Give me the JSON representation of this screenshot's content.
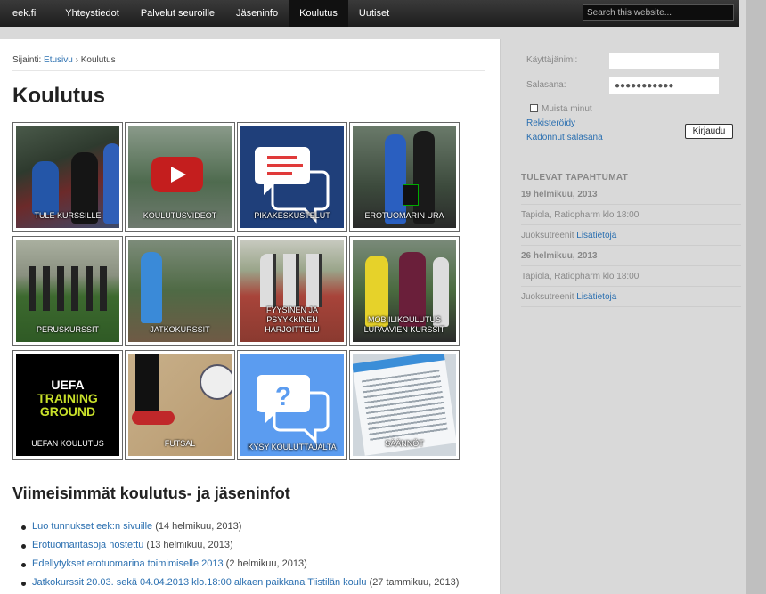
{
  "nav": {
    "items": [
      "eek.fi",
      "Yhteystiedot",
      "Palvelut seuroille",
      "Jäseninfo",
      "Koulutus",
      "Uutiset"
    ],
    "active": "Koulutus",
    "search_placeholder": "Search this website..."
  },
  "breadcrumb": {
    "prefix": "Sijainti:",
    "home": "Etusivu",
    "separator": "›",
    "current": "Koulutus"
  },
  "page_title": "Koulutus",
  "tiles": [
    {
      "label": "TULE KURSSILLE"
    },
    {
      "label": "KOULUTUSVIDEOT"
    },
    {
      "label": "PIKAKESKUSTELUT"
    },
    {
      "label": "EROTUOMARIN URA"
    },
    {
      "label": "PERUSKURSSIT"
    },
    {
      "label": "JATKOKURSSIT"
    },
    {
      "label": "FYYSINEN JA PSYYKKINEN HARJOITTELU"
    },
    {
      "label": "MOBIILIKOULUTUS LUPAAVIEN KURSSIT"
    },
    {
      "label": "UEFAN KOULUTUS",
      "logo": [
        "UEFA",
        "TRAINING",
        "GROUND"
      ]
    },
    {
      "label": "FUTSAL"
    },
    {
      "label": "KYSY KOULUTTAJALTA"
    },
    {
      "label": "SÄÄNNÖT"
    }
  ],
  "latest": {
    "title": "Viimeisimmät koulutus- ja jäseninfot",
    "items": [
      {
        "link": "Luo tunnukset eek:n sivuille",
        "meta": "(14 helmikuu, 2013)"
      },
      {
        "link": "Erotuomaritasoja nostettu",
        "meta": "(13 helmikuu, 2013)"
      },
      {
        "link": "Edellytykset erotuomarina toimimiselle 2013",
        "meta": "(2 helmikuu, 2013)"
      },
      {
        "link": "Jatkokurssit 20.03. sekä 04.04.2013 klo.18:00 alkaen paikkana Tiistilän koulu",
        "meta": "(27 tammikuu, 2013)"
      }
    ]
  },
  "login": {
    "username_label": "Käyttäjänimi:",
    "password_label": "Salasana:",
    "password_value": "●●●●●●●●●●●",
    "remember": "Muista minut",
    "register": "Rekisteröidy",
    "lost_password": "Kadonnut salasana",
    "button": "Kirjaudu"
  },
  "events": {
    "title": "TULEVAT TAPAHTUMAT",
    "list": [
      {
        "date": "19 helmikuu, 2013",
        "place": "Tapiola, Ratiopharm klo 18:00",
        "name": "Juoksutreenit",
        "more": "Lisätietoja"
      },
      {
        "date": "26 helmikuu, 2013",
        "place": "Tapiola, Ratiopharm klo 18:00",
        "name": "Juoksutreenit",
        "more": "Lisätietoja"
      }
    ]
  },
  "colors": {
    "link": "#2a6fb0",
    "nav_bg": "#2b2b2b",
    "tile_chat_blue": "#1f3f7a",
    "tile_light_blue": "#5b9cf0"
  }
}
